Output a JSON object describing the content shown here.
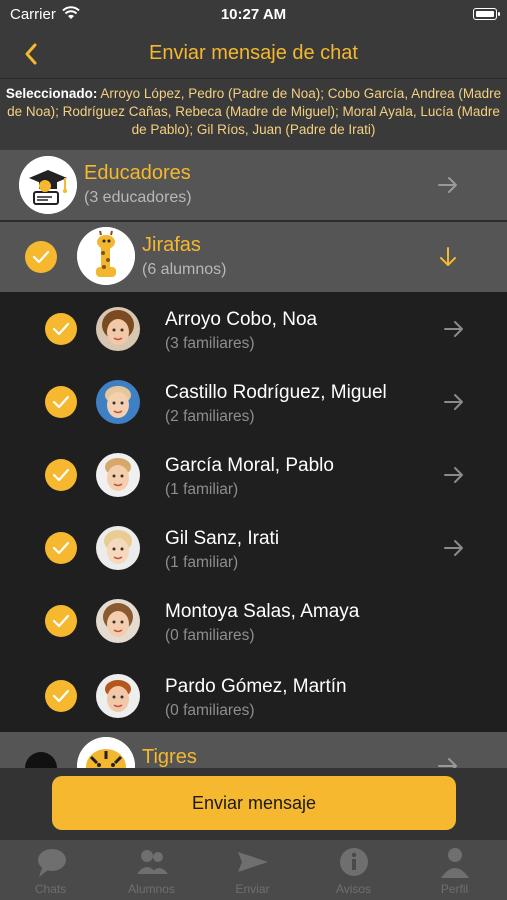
{
  "status": {
    "carrier": "Carrier",
    "time": "10:27 AM"
  },
  "navbar": {
    "title": "Enviar mensaje de chat"
  },
  "selected": {
    "label": "Seleccionado:",
    "text": " Arroyo López, Pedro (Padre de Noa); Cobo García, Andrea (Madre de Noa); Rodríguez Cañas, Rebeca (Madre de Miguel); Moral Ayala, Lucía (Madre de Pablo); Gil Ríos, Juan (Padre de Irati)"
  },
  "groups": [
    {
      "name": "Educadores",
      "sub": "(3 educadores)"
    },
    {
      "name": "Jirafas",
      "sub": "(6 alumnos)"
    },
    {
      "name": "Tigres"
    }
  ],
  "students": [
    {
      "name": "Arroyo Cobo, Noa",
      "sub": "(3 familiares)"
    },
    {
      "name": "Castillo Rodríguez, Miguel",
      "sub": "(2 familiares)"
    },
    {
      "name": "García Moral, Pablo",
      "sub": "(1 familiar)"
    },
    {
      "name": "Gil Sanz, Irati",
      "sub": "(1 familiar)"
    },
    {
      "name": "Montoya Salas, Amaya",
      "sub": "(0 familiares)"
    },
    {
      "name": "Pardo Gómez, Martín",
      "sub": "(0 familiares)"
    }
  ],
  "send_button": "Enviar mensaje",
  "tabs": [
    {
      "label": "Chats",
      "icon": "chat-bubble-icon"
    },
    {
      "label": "Alumnos",
      "icon": "people-icon"
    },
    {
      "label": "Enviar",
      "icon": "send-icon"
    },
    {
      "label": "Avisos",
      "icon": "info-icon"
    },
    {
      "label": "Perfil",
      "icon": "person-icon"
    }
  ],
  "colors": {
    "accent": "#f5b82e",
    "background": "#1f1f1f",
    "bar": "#3a3a3a"
  }
}
